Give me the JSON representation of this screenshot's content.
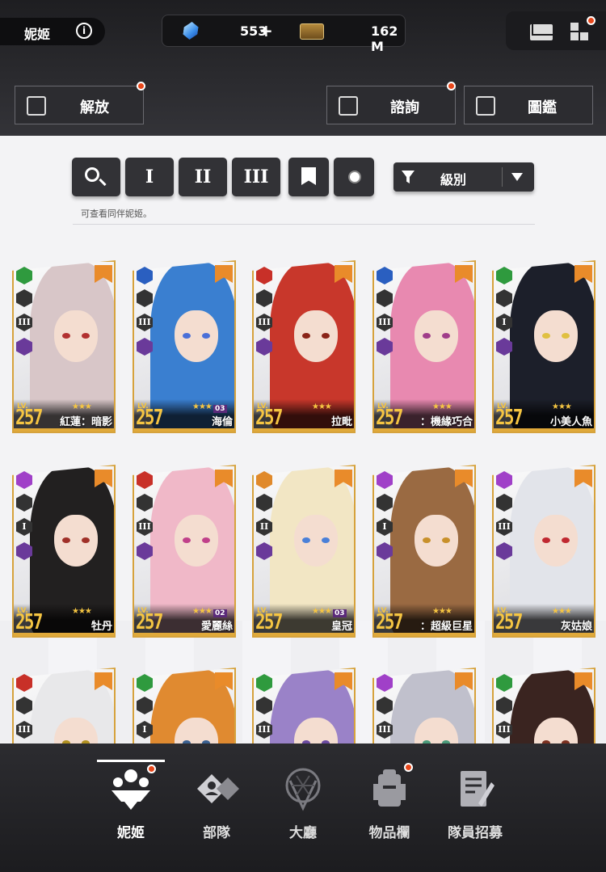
{
  "header": {
    "title": "妮姬",
    "info_symbol": "i",
    "gems": "553",
    "gems_plus": "+",
    "credits": "162 M",
    "icons": [
      "gem-icon",
      "ticket-icon",
      "mail-icon",
      "grid-icon"
    ]
  },
  "actions": {
    "release": "解放",
    "consult": "諮詢",
    "codex": "圖鑑"
  },
  "filters": {
    "burst_1": "I",
    "burst_2": "II",
    "burst_3": "III",
    "sort_label": "級別",
    "hint": "可查看同伴妮姬。"
  },
  "cards": [
    {
      "level": "LV.",
      "level_num": "257",
      "name": "紅蓮：暗影",
      "stars": "★★★",
      "ob": "",
      "burst": "III",
      "hair": "#d8c6c8",
      "eye": "#b23030",
      "elem": "#2f9a3e"
    },
    {
      "level": "LV.",
      "level_num": "257",
      "name": "海倫",
      "stars": "★★★",
      "ob": "03",
      "burst": "III",
      "hair": "#3a7fd0",
      "eye": "#4a6fd8",
      "elem": "#2a5fc0"
    },
    {
      "level": "LV.",
      "level_num": "257",
      "name": "拉毗",
      "stars": "★★★",
      "ob": "",
      "burst": "III",
      "hair": "#c8372b",
      "eye": "#8a2418",
      "elem": "#c83028"
    },
    {
      "level": "LV.",
      "level_num": "257",
      "name": "：機緣巧合",
      "stars": "★★★",
      "ob": "",
      "burst": "III",
      "hair": "#e889b0",
      "eye": "#a03d8a",
      "elem": "#2a5fc0"
    },
    {
      "level": "LV.",
      "level_num": "257",
      "name": "小美人魚",
      "stars": "★★★",
      "ob": "",
      "burst": "I",
      "hair": "#1c1f2a",
      "eye": "#e0c040",
      "elem": "#2f9a3e"
    },
    {
      "level": "LV.",
      "level_num": "257",
      "name": "牡丹",
      "stars": "★★★",
      "ob": "",
      "burst": "I",
      "hair": "#222020",
      "eye": "#a03028",
      "elem": "#a040c8"
    },
    {
      "level": "LV.",
      "level_num": "257",
      "name": "愛麗絲",
      "stars": "★★★",
      "ob": "02",
      "burst": "III",
      "hair": "#f0b8c8",
      "eye": "#c0408a",
      "elem": "#c83028"
    },
    {
      "level": "LV.",
      "level_num": "257",
      "name": "皇冠",
      "stars": "★★★",
      "ob": "03",
      "burst": "II",
      "hair": "#f2e6c4",
      "eye": "#4a80d8",
      "elem": "#e0892a"
    },
    {
      "level": "LV.",
      "level_num": "257",
      "name": "：超級巨星",
      "stars": "★★★",
      "ob": "",
      "burst": "I",
      "hair": "#9a6a42",
      "eye": "#c8902a",
      "elem": "#a040c8"
    },
    {
      "level": "LV.",
      "level_num": "257",
      "name": "灰姑娘",
      "stars": "★★★",
      "ob": "",
      "burst": "III",
      "hair": "#e2e4ea",
      "eye": "#c02830",
      "elem": "#a040c8"
    },
    {
      "level": "",
      "level_num": "",
      "name": "",
      "stars": "",
      "ob": "",
      "burst": "III",
      "hair": "#e8e8ea",
      "eye": "#b09020",
      "elem": "#c83028"
    },
    {
      "level": "",
      "level_num": "",
      "name": "",
      "stars": "",
      "ob": "",
      "burst": "I",
      "hair": "#e08a30",
      "eye": "#3a6090",
      "elem": "#2f9a3e"
    },
    {
      "level": "",
      "level_num": "",
      "name": "",
      "stars": "",
      "ob": "",
      "burst": "III",
      "hair": "#9a82c8",
      "eye": "#6a4aa0",
      "elem": "#2f9a3e"
    },
    {
      "level": "",
      "level_num": "",
      "name": "",
      "stars": "",
      "ob": "",
      "burst": "III",
      "hair": "#c0c0cc",
      "eye": "#4a9a7a",
      "elem": "#a040c8"
    },
    {
      "level": "",
      "level_num": "",
      "name": "",
      "stars": "",
      "ob": "",
      "burst": "III",
      "hair": "#3a2420",
      "eye": "#7a3020",
      "elem": "#2f9a3e"
    }
  ],
  "nav": {
    "nikke": "妮姬",
    "squad": "部隊",
    "lobby": "大廳",
    "inventory": "物品欄",
    "recruit": "隊員招募"
  },
  "colors": {
    "notification": "#e8471b",
    "card_border": "#d6a23c",
    "level_text": "#f5c542"
  }
}
